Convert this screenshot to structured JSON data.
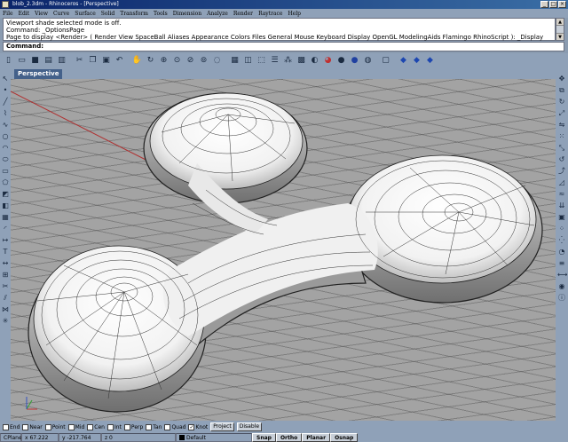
{
  "window": {
    "title": "blob_2.3dm - Rhinoceros - [Perspective]"
  },
  "menu": [
    "File",
    "Edit",
    "View",
    "Curve",
    "Surface",
    "Solid",
    "Transform",
    "Tools",
    "Dimension",
    "Analyze",
    "Render",
    "Raytrace",
    "Help"
  ],
  "command_history": [
    "Viewport shade selected mode is off.",
    "Command: _OptionsPage",
    "Page to display <Render> ( Render  View  SpaceBall  Aliases  Appearance  Colors  Files  General  Mouse  Keyboard  Display  OpenGL  ModelingAids  Flamingo  RhinoScript ): _Display"
  ],
  "command_prompt": {
    "label": "Command:",
    "value": ""
  },
  "viewport": {
    "tab_label": "Perspective"
  },
  "osnaps": [
    {
      "label": "End",
      "checked": false
    },
    {
      "label": "Near",
      "checked": false
    },
    {
      "label": "Point",
      "checked": false
    },
    {
      "label": "Mid",
      "checked": false
    },
    {
      "label": "Cen",
      "checked": false
    },
    {
      "label": "Int",
      "checked": false
    },
    {
      "label": "Perp",
      "checked": false
    },
    {
      "label": "Tan",
      "checked": false
    },
    {
      "label": "Quad",
      "checked": false
    },
    {
      "label": "Knot",
      "checked": true
    }
  ],
  "osnap_buttons": [
    "Project",
    "Disable"
  ],
  "status": {
    "cplane": "CPlane",
    "x": "x 67.222",
    "y": "y -217.764",
    "z": "z 0",
    "layer": "Default",
    "panes": [
      "Snap",
      "Ortho",
      "Planar",
      "Osnap"
    ]
  },
  "colors": {
    "accent": "#44618a",
    "viewport_bg": "#a3a3a3",
    "chrome": "#8fa1b8"
  }
}
